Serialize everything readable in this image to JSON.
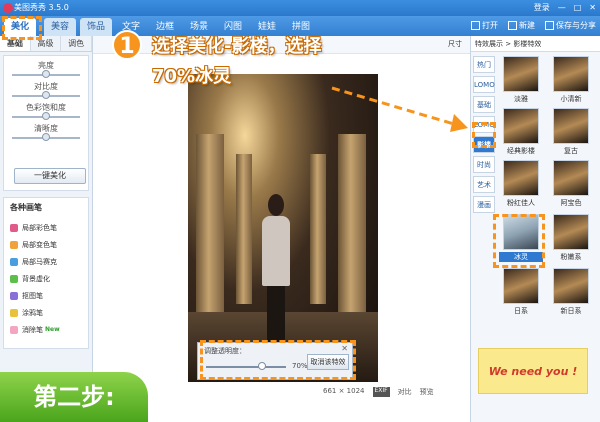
{
  "app": {
    "title": "美图秀秀 3.5.0",
    "window_controls": [
      "登录",
      "最小化",
      "还原",
      "关闭"
    ]
  },
  "nav": {
    "tabs": [
      "美化",
      "美容",
      "饰品",
      "文字",
      "边框",
      "场景",
      "闪图",
      "娃娃",
      "拼图"
    ],
    "actions": [
      "打开",
      "新建",
      "保存与分享"
    ]
  },
  "left": {
    "subtabs": [
      "基础",
      "高级",
      "调色"
    ],
    "sliders": [
      {
        "label": "亮度",
        "level": 0.5
      },
      {
        "label": "对比度",
        "level": 0.5
      },
      {
        "label": "色彩饱和度",
        "level": 0.5
      },
      {
        "label": "清晰度",
        "level": 0.5
      }
    ],
    "one_key": "一键美化",
    "brush_title": "各种画笔",
    "brushes": [
      "局部彩色笔",
      "局部变色笔",
      "局部马赛克",
      "背景虚化",
      "抠图笔",
      "涂鸦笔",
      "消除笔"
    ],
    "new_badge": "New"
  },
  "canvas": {
    "size_label": "尺寸",
    "dialog_title": "调整透明度：",
    "opacity_value": "70%",
    "opacity_level": 0.7,
    "cancel_label": "取消该特效",
    "dimensions": "661 × 1024",
    "exif": "EXIF",
    "compare": "对比",
    "preview": "预览"
  },
  "right": {
    "header": "特效展示 > 影楼特效",
    "categories": [
      "热门",
      "LOMO",
      "基础",
      "LOMO",
      "影楼",
      "时尚",
      "艺术",
      "漫画"
    ],
    "thumbs": [
      "淡雅",
      "小清新",
      "经典影楼",
      "复古",
      "粉红佳人",
      "阿宝色",
      "冰灵",
      "粉嫩系",
      "日系",
      "新日系"
    ],
    "selected": "冰灵"
  },
  "ad": {
    "text": "We need you !"
  },
  "annotation": {
    "number": "1",
    "text_line1": "选择美化-影楼，选择",
    "text_line2": "70%冰灵",
    "step": "第二步:"
  },
  "colors": {
    "accent": "#f7941d",
    "blue": "#2f7ad0",
    "green": "#4aa51c"
  }
}
